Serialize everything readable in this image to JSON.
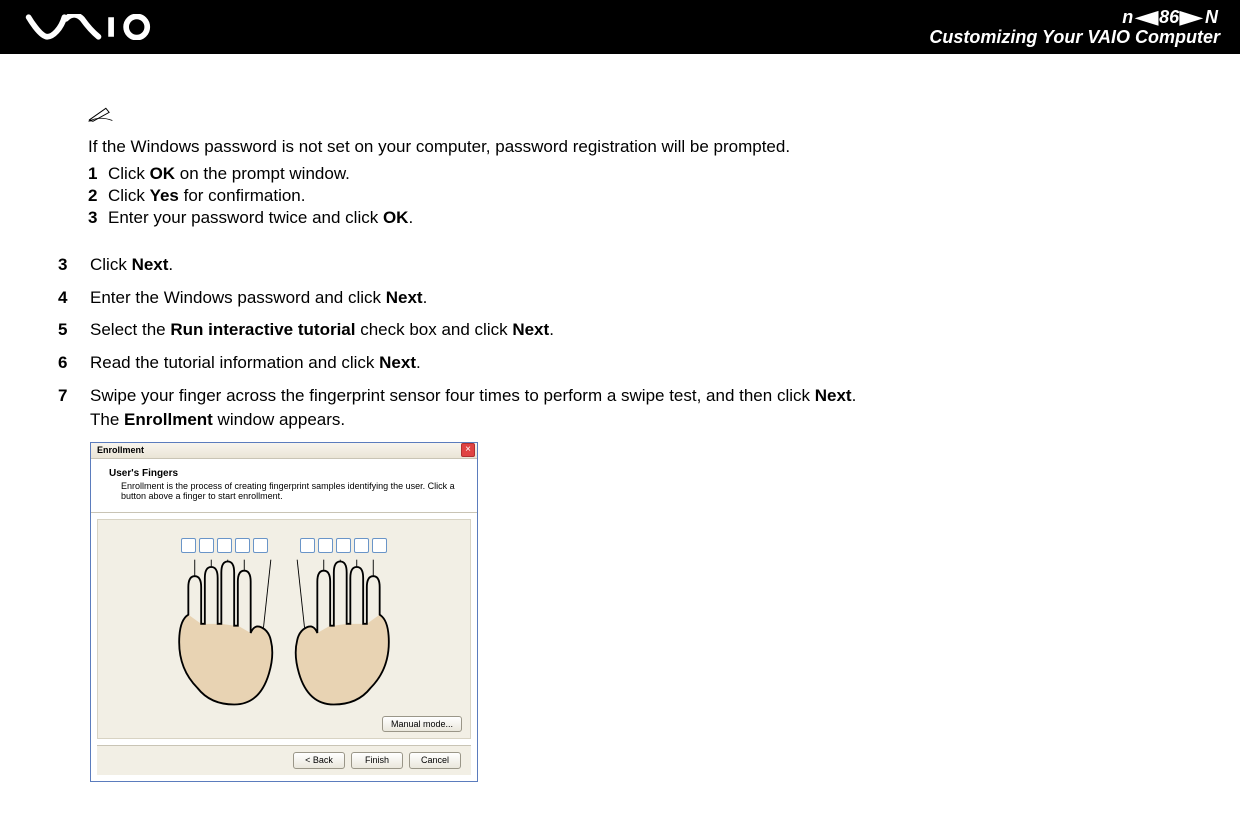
{
  "header": {
    "page_number": "86",
    "nav_n": "n",
    "nav_capital_n": "N",
    "section_title": "Customizing Your VAIO Computer"
  },
  "note": {
    "intro": "If the Windows password is not set on your computer, password registration will be prompted.",
    "substeps": [
      {
        "num": "1",
        "parts": [
          "Click ",
          "OK",
          " on the prompt window."
        ]
      },
      {
        "num": "2",
        "parts": [
          "Click ",
          "Yes",
          " for confirmation."
        ]
      },
      {
        "num": "3",
        "parts": [
          "Enter your password twice and click ",
          "OK",
          "."
        ]
      }
    ]
  },
  "steps": [
    {
      "num": "3",
      "parts": [
        "Click ",
        "Next",
        "."
      ]
    },
    {
      "num": "4",
      "parts": [
        "Enter the Windows password and click ",
        "Next",
        "."
      ]
    },
    {
      "num": "5",
      "parts": [
        "Select the ",
        "Run interactive tutorial",
        " check box and click ",
        "Next",
        "."
      ]
    },
    {
      "num": "6",
      "parts": [
        "Read the tutorial information and click ",
        "Next",
        "."
      ]
    },
    {
      "num": "7",
      "parts": [
        "Swipe your finger across the fingerprint sensor four times to perform a swipe test, and then click ",
        "Next",
        ".\nThe ",
        "Enrollment",
        " window appears."
      ]
    }
  ],
  "enrollment": {
    "title": "Enrollment",
    "header_title": "User's Fingers",
    "header_sub": "Enrollment is the process of creating fingerprint samples identifying the user. Click a button above a finger to start enrollment.",
    "buttons": {
      "manual": "Manual mode...",
      "back": "< Back",
      "finish": "Finish",
      "cancel": "Cancel"
    },
    "close_label": "×"
  }
}
